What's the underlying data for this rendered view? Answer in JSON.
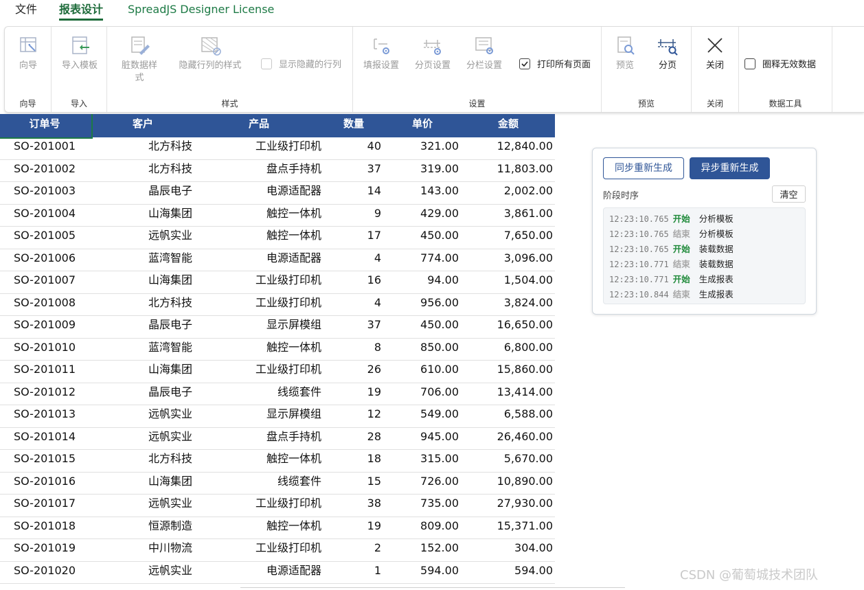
{
  "menu": {
    "file": "文件",
    "report_design": "报表设计",
    "license": "SpreadJS Designer License"
  },
  "ribbon": {
    "wizard": {
      "btn": "向导",
      "group": "向导"
    },
    "import": {
      "btn": "导入模板",
      "group": "导入"
    },
    "style": {
      "dirty_style_line1": "脏数据样",
      "dirty_style_line2": "式",
      "hidden_row_style": "隐藏行列的样式",
      "show_hidden": "显示隐藏的行列",
      "group": "样式"
    },
    "settings": {
      "fill_settings": "填报设置",
      "page_settings": "分页设置",
      "column_settings": "分栏设置",
      "print_all": "打印所有页面",
      "print_all_checked": true,
      "group": "设置"
    },
    "preview": {
      "preview": "预览",
      "paging": "分页",
      "group": "预览"
    },
    "close": {
      "btn": "关闭",
      "group": "关闭"
    },
    "data_tools": {
      "circle_invalid": "圈释无效数据",
      "group": "数据工具"
    }
  },
  "sheet": {
    "headers": [
      "订单号",
      "客户",
      "产品",
      "数量",
      "单价",
      "金额"
    ],
    "rows": [
      [
        "SO-201001",
        "北方科技",
        "工业级打印机",
        "40",
        "321.00",
        "12,840.00"
      ],
      [
        "SO-201002",
        "北方科技",
        "盘点手持机",
        "37",
        "319.00",
        "11,803.00"
      ],
      [
        "SO-201003",
        "晶辰电子",
        "电源适配器",
        "14",
        "143.00",
        "2,002.00"
      ],
      [
        "SO-201004",
        "山海集团",
        "触控一体机",
        "9",
        "429.00",
        "3,861.00"
      ],
      [
        "SO-201005",
        "远帆实业",
        "触控一体机",
        "17",
        "450.00",
        "7,650.00"
      ],
      [
        "SO-201006",
        "蓝湾智能",
        "电源适配器",
        "4",
        "774.00",
        "3,096.00"
      ],
      [
        "SO-201007",
        "山海集团",
        "工业级打印机",
        "16",
        "94.00",
        "1,504.00"
      ],
      [
        "SO-201008",
        "北方科技",
        "工业级打印机",
        "4",
        "956.00",
        "3,824.00"
      ],
      [
        "SO-201009",
        "晶辰电子",
        "显示屏模组",
        "37",
        "450.00",
        "16,650.00"
      ],
      [
        "SO-201010",
        "蓝湾智能",
        "触控一体机",
        "8",
        "850.00",
        "6,800.00"
      ],
      [
        "SO-201011",
        "山海集团",
        "工业级打印机",
        "26",
        "610.00",
        "15,860.00"
      ],
      [
        "SO-201012",
        "晶辰电子",
        "线缆套件",
        "19",
        "706.00",
        "13,414.00"
      ],
      [
        "SO-201013",
        "远帆实业",
        "显示屏模组",
        "12",
        "549.00",
        "6,588.00"
      ],
      [
        "SO-201014",
        "远帆实业",
        "盘点手持机",
        "28",
        "945.00",
        "26,460.00"
      ],
      [
        "SO-201015",
        "北方科技",
        "触控一体机",
        "18",
        "315.00",
        "5,670.00"
      ],
      [
        "SO-201016",
        "山海集团",
        "线缆套件",
        "15",
        "726.00",
        "10,890.00"
      ],
      [
        "SO-201017",
        "远帆实业",
        "工业级打印机",
        "38",
        "735.00",
        "27,930.00"
      ],
      [
        "SO-201018",
        "恒源制造",
        "触控一体机",
        "19",
        "809.00",
        "15,371.00"
      ],
      [
        "SO-201019",
        "中川物流",
        "工业级打印机",
        "2",
        "152.00",
        "304.00"
      ],
      [
        "SO-201020",
        "远帆实业",
        "电源适配器",
        "1",
        "594.00",
        "594.00"
      ]
    ]
  },
  "panel": {
    "sync_btn": "同步重新生成",
    "async_btn": "异步重新生成",
    "timeline_label": "阶段时序",
    "clear_btn": "清空",
    "log": [
      {
        "time": "12:23:10.765",
        "event": "开始",
        "type": "start",
        "stage": "分析模板"
      },
      {
        "time": "12:23:10.765",
        "event": "结束",
        "type": "end",
        "stage": "分析模板"
      },
      {
        "time": "12:23:10.765",
        "event": "开始",
        "type": "start",
        "stage": "装载数据"
      },
      {
        "time": "12:23:10.771",
        "event": "结束",
        "type": "end",
        "stage": "装载数据"
      },
      {
        "time": "12:23:10.771",
        "event": "开始",
        "type": "start",
        "stage": "生成报表"
      },
      {
        "time": "12:23:10.844",
        "event": "结束",
        "type": "end",
        "stage": "生成报表"
      }
    ]
  },
  "watermark": "CSDN @葡萄城技术团队",
  "colors": {
    "header_bg": "#2f5597",
    "accent_green": "#1d6b3a",
    "log_start": "#1f8a3a",
    "log_end": "#a8a8a8"
  }
}
